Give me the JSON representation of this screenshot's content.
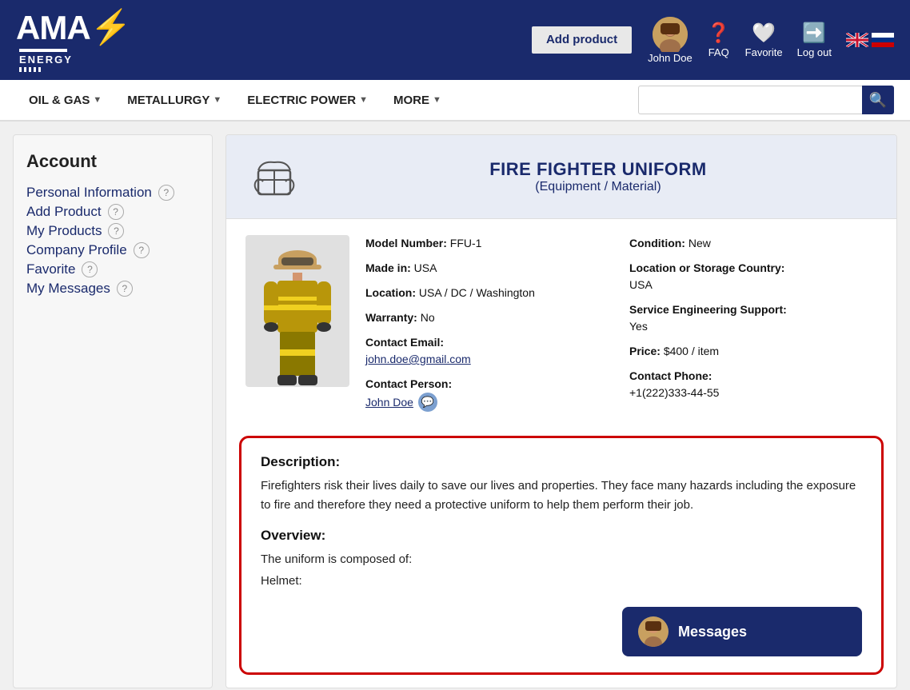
{
  "header": {
    "logo": {
      "ama": "AMA",
      "bolt": "⚡",
      "energy": "ENERGY"
    },
    "add_product": "Add\nproduct",
    "add_product_label": "Add product",
    "user_name": "John Doe",
    "faq_label": "FAQ",
    "favorite_label": "Favorite",
    "logout_label": "Log out"
  },
  "navbar": {
    "items": [
      {
        "label": "OIL & GAS",
        "has_dropdown": true
      },
      {
        "label": "METALLURGY",
        "has_dropdown": true
      },
      {
        "label": "ELECTRIC POWER",
        "has_dropdown": true
      },
      {
        "label": "MORE",
        "has_dropdown": true
      }
    ],
    "search_placeholder": ""
  },
  "sidebar": {
    "title": "Account",
    "menu": [
      {
        "label": "Personal Information",
        "has_help": true
      },
      {
        "label": "Add Product",
        "has_help": true
      },
      {
        "label": "My Products",
        "has_help": true
      },
      {
        "label": "Company Profile",
        "has_help": true
      },
      {
        "label": "Favorite",
        "has_help": true
      },
      {
        "label": "My Messages",
        "has_help": true
      }
    ]
  },
  "product": {
    "title": "FIRE FIGHTER UNIFORM",
    "subtitle": "(Equipment / Material)",
    "details_left": [
      {
        "label": "Model Number:",
        "value": "FFU-1"
      },
      {
        "label": "Made in:",
        "value": "USA"
      },
      {
        "label": "Location:",
        "value": "USA / DC / Washington"
      },
      {
        "label": "Warranty:",
        "value": "No"
      },
      {
        "label": "Contact Email:",
        "value": "john.doe@gmail.com",
        "is_link": true
      },
      {
        "label": "Contact Person:",
        "value": "John Doe",
        "is_link": true,
        "has_chat": true
      }
    ],
    "details_right": [
      {
        "label": "Condition:",
        "value": "New"
      },
      {
        "label": "Location or Storage Country:",
        "value": "USA"
      },
      {
        "label": "Service Engineering Support:",
        "value": "Yes"
      },
      {
        "label": "Price:",
        "value": "$400 / item"
      },
      {
        "label": "Contact Phone:",
        "value": "+1(222)333-44-55"
      }
    ],
    "description_heading": "Description:",
    "description_text": "Firefighters risk their lives daily to save our lives and properties. They face many hazards including the exposure to fire and therefore they need a protective uniform to help them perform their job.",
    "overview_heading": "Overview:",
    "overview_text": "The uniform is composed of:",
    "helmet_text": "Helmet:",
    "messages_label": "Messages"
  }
}
